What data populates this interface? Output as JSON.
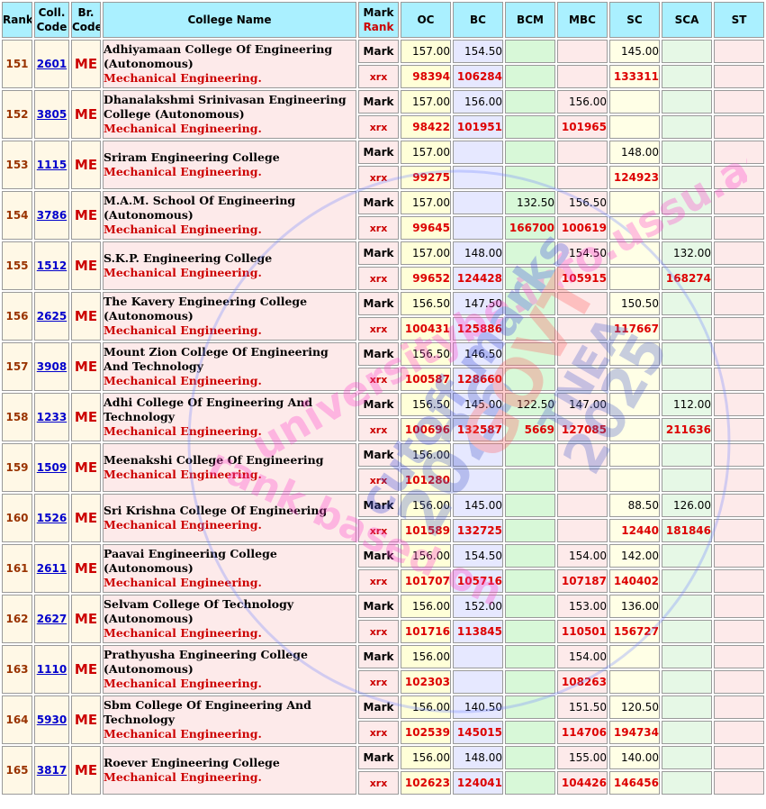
{
  "header": {
    "rank": "Rank",
    "coll_code": "Coll. Code",
    "br_code": "Br. Code",
    "college_name": "College Name",
    "mark": "Mark",
    "rank_label": "Rank",
    "oc": "OC",
    "bc": "BC",
    "bcm": "BCM",
    "mbc": "MBC",
    "sc": "SC",
    "sca": "SCA",
    "st": "ST"
  },
  "labels": {
    "mark": "Mark",
    "rank": "xrx"
  },
  "watermark": {
    "line1": "universitybe.info.ussu.ac",
    "line2": "cutoff marks",
    "line3": "2026",
    "line4": "GOVT",
    "line5": "TNEA",
    "line6": "2025",
    "line7": "rank based on"
  },
  "rows": [
    {
      "rank": "151",
      "code": "2601",
      "branch": "ME",
      "college": "Adhiyamaan College Of Engineering (Autonomous)",
      "branch_name": "Mechanical Engineering.",
      "marks": {
        "oc": "157.00",
        "bc": "154.50",
        "bcm": "",
        "mbc": "",
        "sc": "145.00",
        "sca": "",
        "st": ""
      },
      "ranks": {
        "oc": "98394",
        "bc": "106284",
        "bcm": "",
        "mbc": "",
        "sc": "133311",
        "sca": "",
        "st": ""
      }
    },
    {
      "rank": "152",
      "code": "3805",
      "branch": "ME",
      "college": "Dhanalakshmi Srinivasan Engineering College (Autonomous)",
      "branch_name": "Mechanical Engineering.",
      "marks": {
        "oc": "157.00",
        "bc": "156.00",
        "bcm": "",
        "mbc": "156.00",
        "sc": "",
        "sca": "",
        "st": ""
      },
      "ranks": {
        "oc": "98422",
        "bc": "101951",
        "bcm": "",
        "mbc": "101965",
        "sc": "",
        "sca": "",
        "st": ""
      }
    },
    {
      "rank": "153",
      "code": "1115",
      "branch": "ME",
      "college": "Sriram Engineering College",
      "branch_name": "Mechanical Engineering.",
      "marks": {
        "oc": "157.00",
        "bc": "",
        "bcm": "",
        "mbc": "",
        "sc": "148.00",
        "sca": "",
        "st": ""
      },
      "ranks": {
        "oc": "99275",
        "bc": "",
        "bcm": "",
        "mbc": "",
        "sc": "124923",
        "sca": "",
        "st": ""
      }
    },
    {
      "rank": "154",
      "code": "3786",
      "branch": "ME",
      "college": "M.A.M. School Of Engineering (Autonomous)",
      "branch_name": "Mechanical Engineering.",
      "marks": {
        "oc": "157.00",
        "bc": "",
        "bcm": "132.50",
        "mbc": "156.50",
        "sc": "",
        "sca": "",
        "st": ""
      },
      "ranks": {
        "oc": "99645",
        "bc": "",
        "bcm": "166700",
        "mbc": "100619",
        "sc": "",
        "sca": "",
        "st": ""
      }
    },
    {
      "rank": "155",
      "code": "1512",
      "branch": "ME",
      "college": "S.K.P. Engineering College",
      "branch_name": "Mechanical Engineering.",
      "marks": {
        "oc": "157.00",
        "bc": "148.00",
        "bcm": "",
        "mbc": "154.50",
        "sc": "",
        "sca": "132.00",
        "st": ""
      },
      "ranks": {
        "oc": "99652",
        "bc": "124428",
        "bcm": "",
        "mbc": "105915",
        "sc": "",
        "sca": "168274",
        "st": ""
      }
    },
    {
      "rank": "156",
      "code": "2625",
      "branch": "ME",
      "college": "The Kavery Engineering College (Autonomous)",
      "branch_name": "Mechanical Engineering.",
      "marks": {
        "oc": "156.50",
        "bc": "147.50",
        "bcm": "",
        "mbc": "",
        "sc": "150.50",
        "sca": "",
        "st": ""
      },
      "ranks": {
        "oc": "100431",
        "bc": "125886",
        "bcm": "",
        "mbc": "",
        "sc": "117667",
        "sca": "",
        "st": ""
      }
    },
    {
      "rank": "157",
      "code": "3908",
      "branch": "ME",
      "college": "Mount Zion College Of Engineering And Technology",
      "branch_name": "Mechanical Engineering.",
      "marks": {
        "oc": "156.50",
        "bc": "146.50",
        "bcm": "",
        "mbc": "",
        "sc": "",
        "sca": "",
        "st": ""
      },
      "ranks": {
        "oc": "100587",
        "bc": "128660",
        "bcm": "",
        "mbc": "",
        "sc": "",
        "sca": "",
        "st": ""
      }
    },
    {
      "rank": "158",
      "code": "1233",
      "branch": "ME",
      "college": "Adhi College Of Engineering And Technology",
      "branch_name": "Mechanical Engineering.",
      "marks": {
        "oc": "156.50",
        "bc": "145.00",
        "bcm": "122.50",
        "mbc": "147.00",
        "sc": "",
        "sca": "112.00",
        "st": ""
      },
      "ranks": {
        "oc": "100696",
        "bc": "132587",
        "bcm": "5669",
        "mbc": "127085",
        "sc": "",
        "sca": "211636",
        "st": ""
      }
    },
    {
      "rank": "159",
      "code": "1509",
      "branch": "ME",
      "college": "Meenakshi College Of Engineering",
      "branch_name": "Mechanical Engineering.",
      "marks": {
        "oc": "156.00",
        "bc": "",
        "bcm": "",
        "mbc": "",
        "sc": "",
        "sca": "",
        "st": ""
      },
      "ranks": {
        "oc": "101280",
        "bc": "",
        "bcm": "",
        "mbc": "",
        "sc": "",
        "sca": "",
        "st": ""
      }
    },
    {
      "rank": "160",
      "code": "1526",
      "branch": "ME",
      "college": "Sri Krishna College Of Engineering",
      "branch_name": "Mechanical Engineering.",
      "marks": {
        "oc": "156.00",
        "bc": "145.00",
        "bcm": "",
        "mbc": "",
        "sc": "88.50",
        "sca": "126.00",
        "st": ""
      },
      "ranks": {
        "oc": "101589",
        "bc": "132725",
        "bcm": "",
        "mbc": "",
        "sc": "12440",
        "sca": "181846",
        "st": ""
      }
    },
    {
      "rank": "161",
      "code": "2611",
      "branch": "ME",
      "college": "Paavai Engineering College (Autonomous)",
      "branch_name": "Mechanical Engineering.",
      "marks": {
        "oc": "156.00",
        "bc": "154.50",
        "bcm": "",
        "mbc": "154.00",
        "sc": "142.00",
        "sca": "",
        "st": ""
      },
      "ranks": {
        "oc": "101707",
        "bc": "105716",
        "bcm": "",
        "mbc": "107187",
        "sc": "140402",
        "sca": "",
        "st": ""
      }
    },
    {
      "rank": "162",
      "code": "2627",
      "branch": "ME",
      "college": "Selvam College Of Technology (Autonomous)",
      "branch_name": "Mechanical Engineering.",
      "marks": {
        "oc": "156.00",
        "bc": "152.00",
        "bcm": "",
        "mbc": "153.00",
        "sc": "136.00",
        "sca": "",
        "st": ""
      },
      "ranks": {
        "oc": "101716",
        "bc": "113845",
        "bcm": "",
        "mbc": "110501",
        "sc": "156727",
        "sca": "",
        "st": ""
      }
    },
    {
      "rank": "163",
      "code": "1110",
      "branch": "ME",
      "college": "Prathyusha Engineering College (Autonomous)",
      "branch_name": "Mechanical Engineering.",
      "marks": {
        "oc": "156.00",
        "bc": "",
        "bcm": "",
        "mbc": "154.00",
        "sc": "",
        "sca": "",
        "st": ""
      },
      "ranks": {
        "oc": "102303",
        "bc": "",
        "bcm": "",
        "mbc": "108263",
        "sc": "",
        "sca": "",
        "st": ""
      }
    },
    {
      "rank": "164",
      "code": "5930",
      "branch": "ME",
      "college": "Sbm College Of Engineering And Technology",
      "branch_name": "Mechanical Engineering.",
      "marks": {
        "oc": "156.00",
        "bc": "140.50",
        "bcm": "",
        "mbc": "151.50",
        "sc": "120.50",
        "sca": "",
        "st": ""
      },
      "ranks": {
        "oc": "102539",
        "bc": "145015",
        "bcm": "",
        "mbc": "114706",
        "sc": "194734",
        "sca": "",
        "st": ""
      }
    },
    {
      "rank": "165",
      "code": "3817",
      "branch": "ME",
      "college": "Roever Engineering College",
      "branch_name": "Mechanical Engineering.",
      "marks": {
        "oc": "156.00",
        "bc": "148.00",
        "bcm": "",
        "mbc": "155.00",
        "sc": "140.00",
        "sca": "",
        "st": ""
      },
      "ranks": {
        "oc": "102623",
        "bc": "124041",
        "bcm": "",
        "mbc": "104426",
        "sc": "146456",
        "sca": "",
        "st": ""
      }
    }
  ]
}
